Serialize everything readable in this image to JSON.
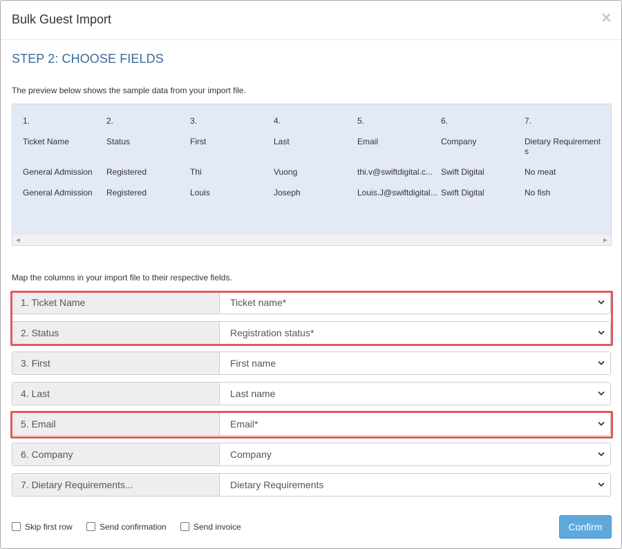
{
  "modal": {
    "title": "Bulk Guest Import",
    "close_glyph": "×"
  },
  "step": {
    "title": "STEP 2: CHOOSE FIELDS",
    "preview_note": "The preview below shows the sample data from your import file.",
    "map_note": "Map the columns in your import file to their respective fields."
  },
  "preview": {
    "columns": [
      {
        "index": "1.",
        "header": "Ticket Name",
        "rows": [
          "General Admission",
          "General Admission"
        ]
      },
      {
        "index": "2.",
        "header": "Status",
        "rows": [
          "Registered",
          "Registered"
        ]
      },
      {
        "index": "3.",
        "header": "First",
        "rows": [
          "Thi",
          "Louis"
        ]
      },
      {
        "index": "4.",
        "header": "Last",
        "rows": [
          "Vuong",
          "Joseph"
        ]
      },
      {
        "index": "5.",
        "header": "Email",
        "rows": [
          "thi.v@swiftdigital.c...",
          "Louis.J@swiftdigital..."
        ]
      },
      {
        "index": "6.",
        "header": "Company",
        "rows": [
          "Swift Digital",
          "Swift Digital"
        ]
      },
      {
        "index": "7.",
        "header": "Dietary Requirements",
        "rows": [
          "No meat",
          "No fish"
        ]
      }
    ],
    "scroll_left_glyph": "◀",
    "scroll_right_glyph": "▶"
  },
  "mappings": [
    {
      "label": "1. Ticket Name",
      "selected": "Ticket name*"
    },
    {
      "label": "2. Status",
      "selected": "Registration status*"
    },
    {
      "label": "3. First",
      "selected": "First name"
    },
    {
      "label": "4. Last",
      "selected": "Last name"
    },
    {
      "label": "5. Email",
      "selected": "Email*"
    },
    {
      "label": "6. Company",
      "selected": "Company"
    },
    {
      "label": "7. Dietary Requirements...",
      "selected": "Dietary Requirements"
    }
  ],
  "options": {
    "skip_first_row": "Skip first row",
    "send_confirmation": "Send confirmation",
    "send_invoice": "Send invoice"
  },
  "actions": {
    "confirm": "Confirm"
  },
  "colors": {
    "step_title": "#3b6a99",
    "preview_bg": "#e3eaf6",
    "highlight": "#e05a5a",
    "confirm_bg": "#5fa8dc"
  },
  "icons": {
    "close": "close-icon",
    "dropdown": "chevron-down-icon",
    "scroll_left": "scroll-left-arrow-icon",
    "scroll_right": "scroll-right-arrow-icon"
  }
}
